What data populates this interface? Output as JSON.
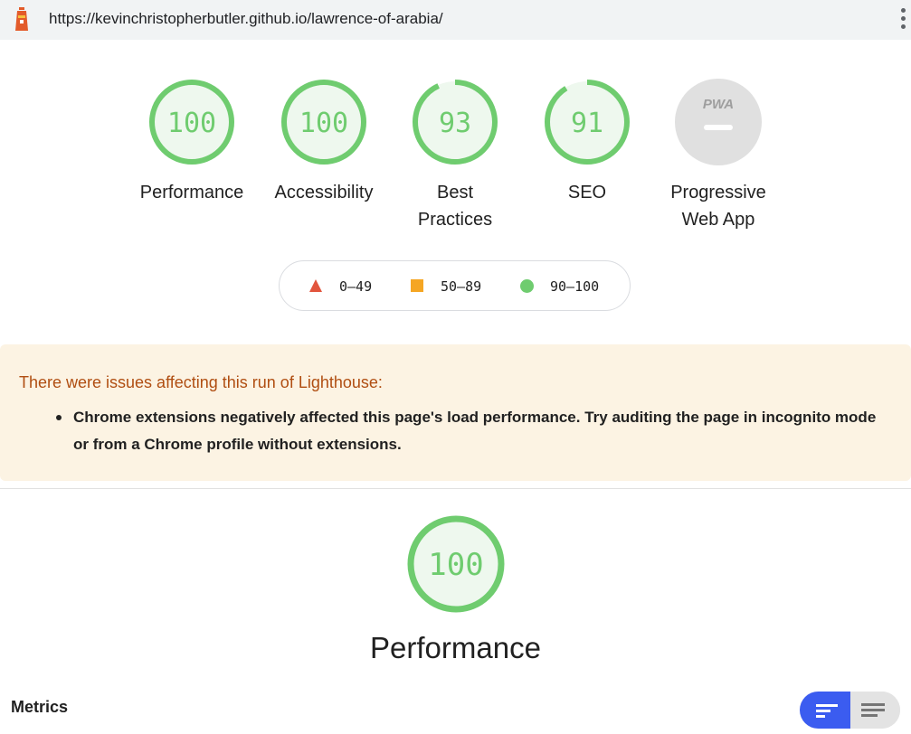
{
  "browser": {
    "url": "https://kevinchristopherbutler.github.io/lawrence-of-arabia/",
    "logo_icon": "lighthouse-icon",
    "menu_icon": "kebab-menu-icon"
  },
  "gauges": [
    {
      "score": "100",
      "label": "Performance",
      "fraction": 1.0
    },
    {
      "score": "100",
      "label": "Accessibility",
      "fraction": 1.0
    },
    {
      "score": "93",
      "label_line1": "Best",
      "label_line2": "Practices",
      "fraction": 0.93
    },
    {
      "score": "91",
      "label": "SEO",
      "fraction": 0.91
    },
    {
      "badge": "PWA",
      "label_line1": "Progressive",
      "label_line2": "Web App"
    }
  ],
  "legend": {
    "fail": "0–49",
    "average": "50–89",
    "pass": "90–100"
  },
  "warning": {
    "title": "There were issues affecting this run of Lighthouse:",
    "items": [
      "Chrome extensions negatively affected this page's load performance. Try auditing the page in incognito mode or from a Chrome profile without extensions."
    ]
  },
  "category": {
    "score": "100",
    "title": "Performance",
    "fraction": 1.0
  },
  "metrics": {
    "label": "Metrics",
    "view_toggle_left_icon": "compact-view-icon",
    "view_toggle_right_icon": "expanded-view-icon"
  },
  "colors": {
    "pass": "#0cce6b",
    "pass_ring": "#6fcc6f",
    "pass_text": "#6fcc6f",
    "pass_fill": "#eef8ee",
    "average": "#f5a623",
    "fail": "#e2553d",
    "pwa_gray": "#e0e0e0",
    "warning_bg": "#fcf3e3",
    "warning_text": "#b04e12",
    "toggle_active": "#3b5cf0"
  }
}
